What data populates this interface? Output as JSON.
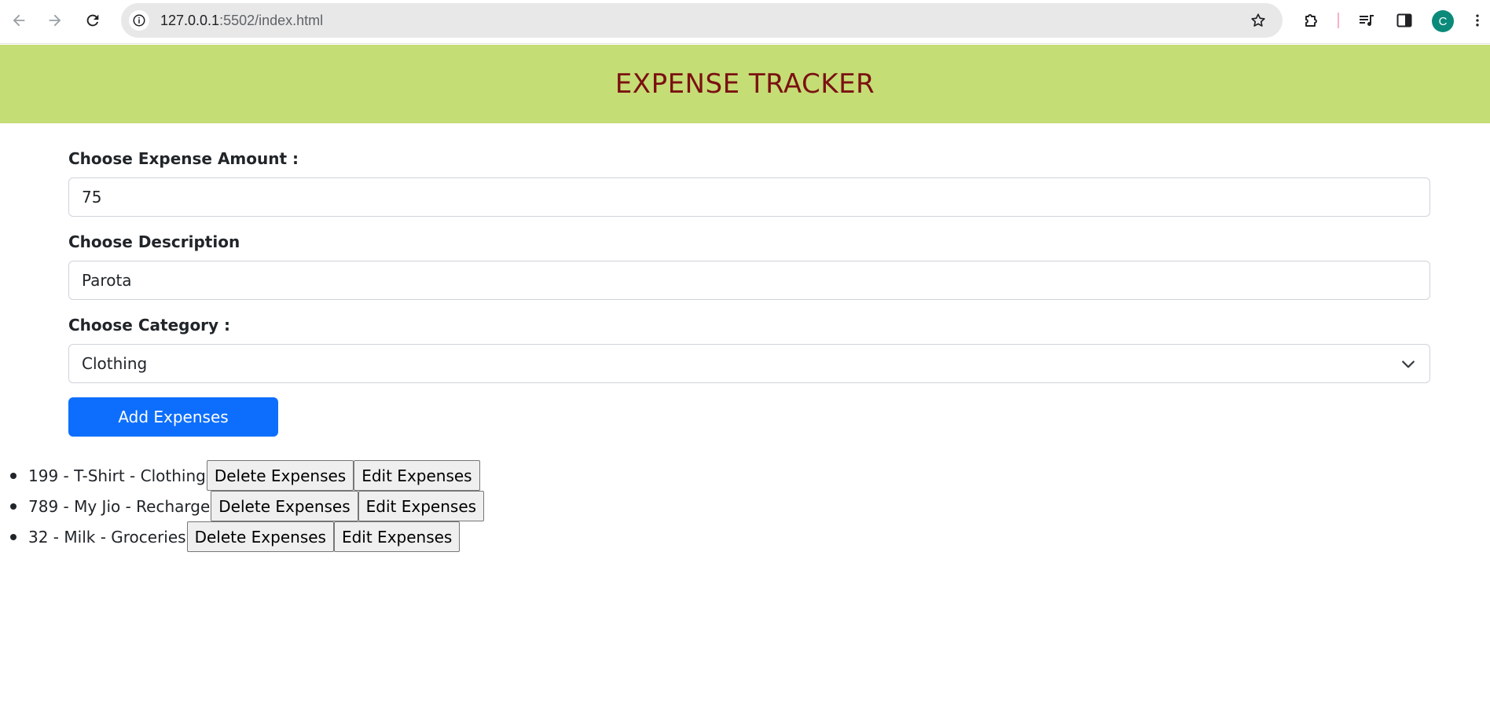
{
  "browser": {
    "url_host": "127.0.0.1",
    "url_path": ":5502/index.html",
    "avatar_initial": "C"
  },
  "header": {
    "title": "EXPENSE TRACKER",
    "background": "#c5dd75",
    "title_color": "#7a1111"
  },
  "form": {
    "amount_label": "Choose Expense Amount :",
    "amount_value": "75",
    "description_label": "Choose Description",
    "description_value": "Parota",
    "category_label": "Choose Category :",
    "category_value": "Clothing",
    "add_button_label": "Add Expenses",
    "add_button_color": "#0d6efd"
  },
  "expenses": [
    {
      "text": "199 - T-Shirt - Clothing",
      "delete_label": "Delete Expenses",
      "edit_label": "Edit Expenses"
    },
    {
      "text": "789 - My Jio - Recharge",
      "delete_label": "Delete Expenses",
      "edit_label": "Edit Expenses"
    },
    {
      "text": "32 - Milk - Groceries",
      "delete_label": "Delete Expenses",
      "edit_label": "Edit Expenses"
    }
  ],
  "icons": {
    "back": "arrow-left-icon",
    "forward": "arrow-right-icon",
    "reload": "reload-icon",
    "site_info": "info-icon",
    "bookmark": "star-icon",
    "extensions": "puzzle-icon",
    "media": "media-queue-icon",
    "side_panel": "side-panel-icon",
    "menu": "kebab-menu-icon",
    "dropdown": "chevron-down-icon"
  }
}
